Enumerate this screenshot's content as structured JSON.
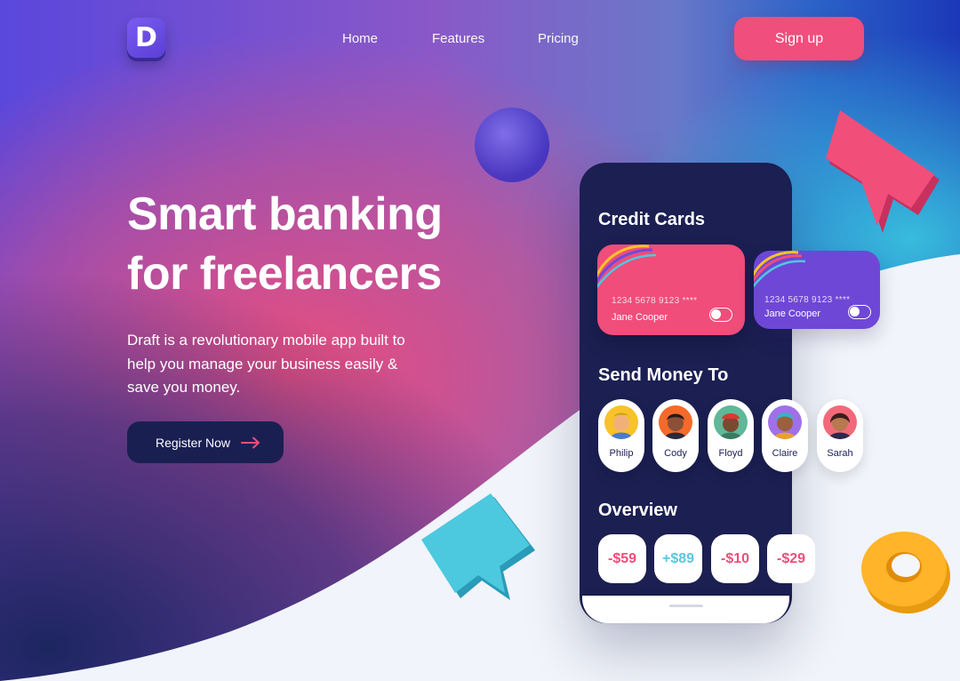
{
  "nav": {
    "logo_letter": "D",
    "links": [
      "Home",
      "Features",
      "Pricing"
    ],
    "signup_label": "Sign up"
  },
  "hero": {
    "title_line1": "Smart banking",
    "title_line2": "for freelancers",
    "description": "Draft is a revolutionary mobile app built to help you manage your business easily & save you money.",
    "cta_label": "Register Now"
  },
  "phone": {
    "credit_cards_title": "Credit Cards",
    "cards": [
      {
        "number": "1234 5678 9123 ****",
        "holder": "Jane Cooper",
        "color": "#f04d7a"
      },
      {
        "number": "1234 5678 9123 ****",
        "holder": "Jane Cooper",
        "color": "#6f47d6"
      }
    ],
    "send_money_title": "Send Money To",
    "contacts": [
      "Philip",
      "Cody",
      "Floyd",
      "Claire",
      "Sarah"
    ],
    "overview_title": "Overview",
    "amounts": [
      {
        "value": "-$59",
        "color": "#f04d7a"
      },
      {
        "value": "+$89",
        "color": "#5bc7dc"
      },
      {
        "value": "-$10",
        "color": "#f04d7a"
      },
      {
        "value": "-$29",
        "color": "#f04d7a"
      }
    ]
  },
  "colors": {
    "accent": "#f04e7c",
    "navy": "#1b1f52",
    "purple": "#6f47d6"
  }
}
